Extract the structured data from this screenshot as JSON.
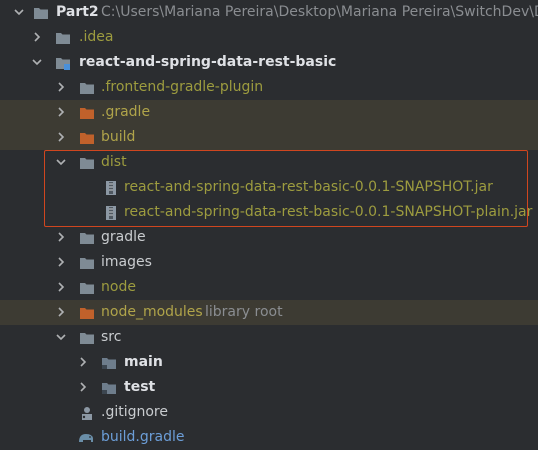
{
  "colors": {
    "background": "#2b2d30",
    "excluded_row_bg": "#3d3b33",
    "annotation": "#d0461f",
    "folder": "#7f8b95",
    "excluded_folder": "#c0612b",
    "source_folder": "#6e7d8c"
  },
  "tree": {
    "root": {
      "label": "Part2",
      "path": "C:\\Users\\Mariana Pereira\\Desktop\\Mariana Pereira\\SwitchDev\\Dev"
    },
    "idea": {
      "label": ".idea"
    },
    "module": {
      "label": "react-and-spring-data-rest-basic"
    },
    "frontend_plugin": {
      "label": ".frontend-gradle-plugin"
    },
    "gradle_hidden": {
      "label": ".gradle"
    },
    "build": {
      "label": "build"
    },
    "dist": {
      "label": "dist"
    },
    "jar1": {
      "label": "react-and-spring-data-rest-basic-0.0.1-SNAPSHOT.jar"
    },
    "jar2": {
      "label": "react-and-spring-data-rest-basic-0.0.1-SNAPSHOT-plain.jar"
    },
    "gradle": {
      "label": "gradle"
    },
    "images": {
      "label": "images"
    },
    "node": {
      "label": "node"
    },
    "node_modules": {
      "label": "node_modules",
      "suffix": "library root"
    },
    "src": {
      "label": "src"
    },
    "main": {
      "label": "main"
    },
    "test": {
      "label": "test"
    },
    "gitignore": {
      "label": ".gitignore"
    },
    "build_gradle": {
      "label": "build.gradle"
    }
  },
  "icons": {
    "arrow_right": "chevron-right-icon",
    "arrow_down": "chevron-down-icon",
    "folder": "folder-icon",
    "module": "module-icon",
    "jar": "jar-icon",
    "gitignore": "gitignore-icon",
    "gradle": "gradle-elephant-icon"
  }
}
